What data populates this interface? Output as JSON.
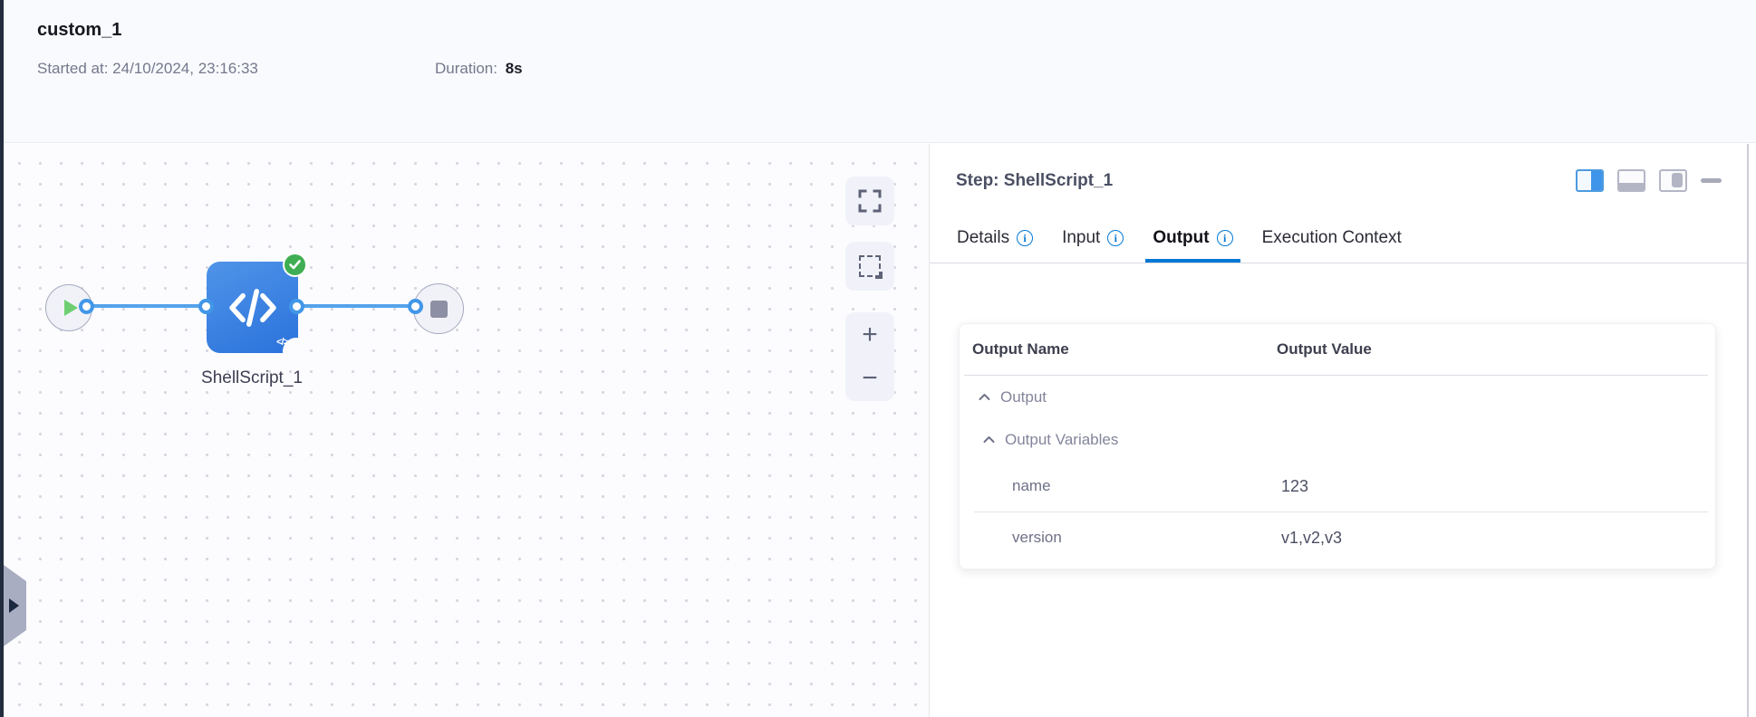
{
  "header": {
    "title": "custom_1",
    "started_label": "Started at:",
    "started_value": "24/10/2024, 23:16:33",
    "duration_label": "Duration:",
    "duration_value": "8s"
  },
  "canvas": {
    "node_label": "ShellScript_1",
    "node_icon": "code-brackets",
    "status": "success",
    "zoom_in_label": "+",
    "zoom_out_label": "−"
  },
  "panel": {
    "title": "Step: ShellScript_1",
    "tabs": [
      {
        "label": "Details",
        "has_info": true,
        "active": false
      },
      {
        "label": "Input",
        "has_info": true,
        "active": false
      },
      {
        "label": "Output",
        "has_info": true,
        "active": true
      },
      {
        "label": "Execution Context",
        "has_info": false,
        "active": false
      }
    ],
    "table": {
      "columns": [
        "Output Name",
        "Output Value"
      ],
      "groups": [
        {
          "label": "Output",
          "level": 0,
          "expanded": true
        },
        {
          "label": "Output Variables",
          "level": 1,
          "expanded": true
        }
      ],
      "rows": [
        {
          "name": "name",
          "value": "123"
        },
        {
          "name": "version",
          "value": "v1,v2,v3"
        }
      ]
    }
  },
  "colors": {
    "accent_blue": "#0278d5",
    "node_blue": "#3580e2",
    "connector_blue": "#55a3eb",
    "success_green": "#3fae53",
    "canvas_dot": "#d6d7e1",
    "header_bg": "#f9fafd"
  }
}
